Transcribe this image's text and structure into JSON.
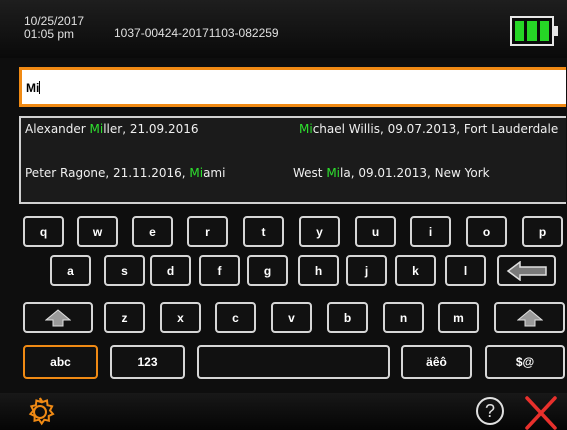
{
  "header": {
    "date": "10/25/2017",
    "time": "01:05 pm",
    "doc_id": "1037-00424-20171103-082259",
    "battery_level": 1.0,
    "battery_color": "#26d626"
  },
  "search": {
    "value": "Mi",
    "accent": "#f08a14"
  },
  "results": [
    {
      "pre": "Alexander ",
      "match": "Mi",
      "post": "ller, 21.09.2016"
    },
    {
      "pre": "",
      "match": "Mi",
      "post": "chael Willis, 09.07.2013, Fort Lauderdale"
    },
    {
      "pre": "Peter Ragone, 21.11.2016, ",
      "match": "Mi",
      "post": "ami"
    },
    {
      "pre": "West ",
      "match": "Mi",
      "post": "la, 09.01.2013, New York"
    }
  ],
  "keyboard": {
    "row1": [
      "q",
      "w",
      "e",
      "r",
      "t",
      "y",
      "u",
      "i",
      "o",
      "p"
    ],
    "row2": [
      "a",
      "s",
      "d",
      "f",
      "g",
      "h",
      "j",
      "k",
      "l"
    ],
    "row3": [
      "z",
      "x",
      "c",
      "v",
      "b",
      "n",
      "m"
    ],
    "abc": "abc",
    "num": "123",
    "accents": "äêô",
    "symbols": "$@"
  },
  "footer": {
    "settings_icon": "gear-icon",
    "help_icon": "help-icon",
    "close_icon": "close-icon"
  }
}
